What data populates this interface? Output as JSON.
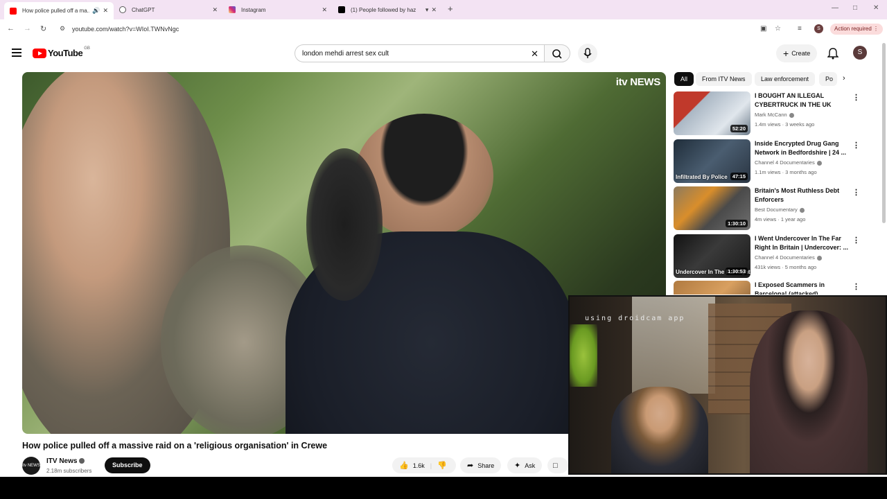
{
  "browser": {
    "tabs": [
      {
        "title": "How police pulled off a ma...",
        "favicon_color": "#ff0000",
        "active": true
      },
      {
        "title": "ChatGPT",
        "favicon_color": "#555555",
        "active": false
      },
      {
        "title": "Instagram",
        "favicon_color": "#d62976",
        "active": false
      },
      {
        "title": "(1) People followed by haz",
        "favicon_color": "#000000",
        "active": false
      }
    ],
    "url": "youtube.com/watch?v=WIoI.TWNvNgc",
    "action_required": "Action required",
    "profile_initial": "S"
  },
  "youtube": {
    "logo_text": "YouTube",
    "region": "GB",
    "search_query": "london mehdi arrest sex cult",
    "create_label": "Create",
    "avatar_initial": "S"
  },
  "video": {
    "watermark": "itv NEWS",
    "title": "How police pulled off a massive raid on a 'religious organisation' in Crewe",
    "channel": "ITV News",
    "channel_avatar_text": "itv NEWS",
    "subscribers": "2.18m subscribers",
    "subscribe_label": "Subscribe",
    "likes": "1.6k",
    "share_label": "Share",
    "ask_label": "Ask"
  },
  "chips": [
    "All",
    "From ITV News",
    "Law enforcement",
    "Po"
  ],
  "recommended": [
    {
      "title": "I BOUGHT AN ILLEGAL CYBERTRUCK IN THE UK",
      "channel": "Mark McCann",
      "meta": "1.4m views · 3 weeks ago",
      "duration": "52:20",
      "thumb_label": "",
      "thumb_color": "#8a9aa8"
    },
    {
      "title": "Inside Encrypted Drug Gang Network in Bedfordshire | 24 ...",
      "channel": "Channel 4 Documentaries",
      "meta": "1.1m views · 3 months ago",
      "duration": "47:15",
      "thumb_label": "Infiltrated By Police",
      "thumb_color": "#3a4a5a"
    },
    {
      "title": "Britain's Most Ruthless Debt Enforcers",
      "channel": "Best Documentary",
      "meta": "4m views · 1 year ago",
      "duration": "1:30:10",
      "thumb_label": "",
      "thumb_color": "#5a5248"
    },
    {
      "title": "I Went Undercover In The Far Right In Britain | Undercover: ...",
      "channel": "Channel 4 Documentaries",
      "meta": "431k views · 5 months ago",
      "duration": "1:30:53",
      "thumb_label": "Undercover In The Far Right",
      "thumb_color": "#2e2e2e"
    },
    {
      "title": "I Exposed Scammers in Barcelona! (attacked)",
      "channel": "",
      "meta": "",
      "duration": "",
      "thumb_label": "",
      "thumb_color": "#b07a40"
    }
  ],
  "webcam": {
    "overlay_text": "using droidcam app"
  }
}
